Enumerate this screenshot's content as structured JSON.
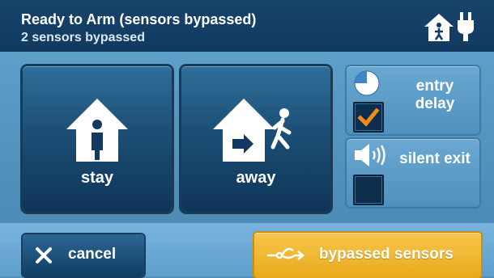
{
  "header": {
    "title": "Ready to Arm (sensors bypassed)",
    "subtitle": "2 sensors bypassed",
    "status_icons": [
      "home-person-icon",
      "power-plug-icon"
    ]
  },
  "arm_buttons": {
    "stay": {
      "label": "stay",
      "icon": "house-person-icon"
    },
    "away": {
      "label": "away",
      "icon": "house-exit-walking-person-icon"
    }
  },
  "options": {
    "entry_delay": {
      "label": "entry delay",
      "icon": "clock-pie-icon",
      "checked": true
    },
    "silent_exit": {
      "label": "silent exit",
      "icon": "speaker-icon",
      "checked": false
    }
  },
  "footer": {
    "cancel": {
      "label": "cancel",
      "icon": "close-x-icon"
    },
    "bypassed_sensors": {
      "label": "bypassed sensors",
      "icon": "bypass-arrow-icon"
    }
  },
  "colors": {
    "header_bg": "#17436b",
    "panel_bg": "#5d9fc9",
    "button_dark": "#1c4f76",
    "accent_yellow": "#f2b933",
    "check_orange": "#f08c1a"
  }
}
